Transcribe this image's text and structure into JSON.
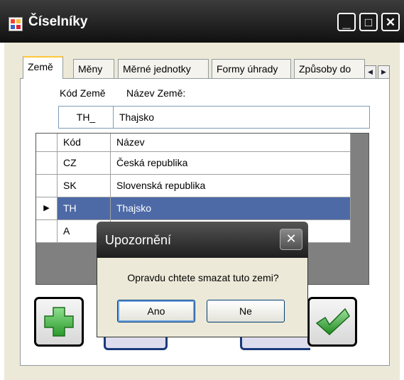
{
  "window": {
    "title": "Číselníky",
    "minimize": "_",
    "maximize": "□",
    "close": "✕"
  },
  "tabs": [
    {
      "label": "Země"
    },
    {
      "label": "Měny"
    },
    {
      "label": "Měrné jednotky"
    },
    {
      "label": "Formy úhrady"
    },
    {
      "label": "Způsoby do"
    }
  ],
  "tab_scroll": {
    "left": "◀",
    "right": "▶"
  },
  "form": {
    "code_label": "Kód Země",
    "name_label": "Název Země:",
    "code_value": "TH_",
    "name_value": "Thajsko"
  },
  "grid": {
    "columns": [
      "Kód",
      "Název"
    ],
    "rows": [
      {
        "indicator": "",
        "code": "CZ",
        "name": "Česká republika"
      },
      {
        "indicator": "",
        "code": "SK",
        "name": "Slovenská republika"
      },
      {
        "indicator": "▶",
        "code": "TH",
        "name": "Thajsko"
      },
      {
        "indicator": "",
        "code": "A",
        "name": ""
      }
    ]
  },
  "dialog": {
    "title": "Upozornění",
    "message": "Opravdu chtete smazat tuto zemi?",
    "yes": "Ano",
    "no": "Ne",
    "close": "✕"
  },
  "icons": {
    "add": "plus-icon",
    "confirm": "checkmark-icon"
  },
  "colors": {
    "selection": "#4d6aa7",
    "add_green": "#3cb43c",
    "check_green": "#2f9e2f"
  }
}
